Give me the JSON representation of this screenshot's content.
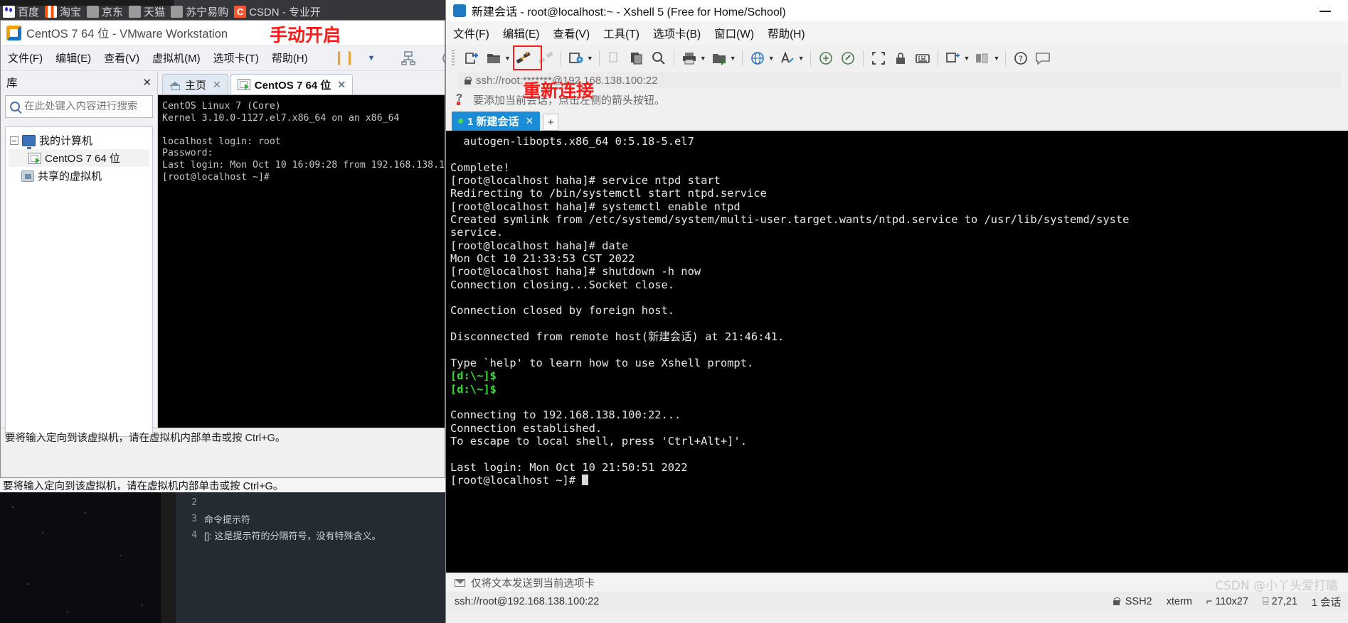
{
  "browser": {
    "bookmarks": [
      {
        "label": "百度",
        "icon": "baidu-favicon"
      },
      {
        "label": "淘宝",
        "icon": "taobao-favicon"
      },
      {
        "label": "京东",
        "icon": "jd-favicon"
      },
      {
        "label": "天猫",
        "icon": "tmall-favicon"
      },
      {
        "label": "苏宁易购",
        "icon": "suning-favicon"
      },
      {
        "label": "CSDN - 专业开",
        "icon": "csdn-favicon"
      }
    ]
  },
  "vmware": {
    "title": "CentOS 7 64 位 - VMware Workstation",
    "annotation": "手动开启",
    "menu": [
      "文件(F)",
      "编辑(E)",
      "查看(V)",
      "虚拟机(M)",
      "选项卡(T)",
      "帮助(H)"
    ],
    "library": {
      "header": "库",
      "close_label": "✕",
      "search_placeholder": "在此处键入内容进行搜索",
      "tree": [
        {
          "label": "我的计算机",
          "icon": "my-computer-icon"
        },
        {
          "label": "CentOS 7 64 位",
          "icon": "virtual-machine-icon"
        },
        {
          "label": "共享的虚拟机",
          "icon": "shared-vms-icon"
        }
      ]
    },
    "tabs": [
      {
        "label": "主页",
        "icon": "home-icon",
        "active": false
      },
      {
        "label": "CentOS 7 64 位",
        "icon": "vm-icon",
        "active": true
      }
    ],
    "console_text": "CentOS Linux 7 (Core)\nKernel 3.10.0-1127.el7.x86_64 on an x86_64\n\nlocalhost login: root\nPassword:\nLast login: Mon Oct 10 16:09:28 from 192.168.138.1\n[root@localhost ~]#",
    "status": "要将输入定向到该虚拟机，请在虚拟机内部单击或按 Ctrl+G。"
  },
  "xshell": {
    "title": "新建会话 - root@localhost:~ - Xshell 5 (Free for Home/School)",
    "minimize_label": "—",
    "menu": [
      "文件(F)",
      "编辑(E)",
      "查看(V)",
      "工具(T)",
      "选项卡(B)",
      "窗口(W)",
      "帮助(H)"
    ],
    "toolbar_icons": [
      "new-session-icon",
      "open-folder-icon",
      "folder-dropdown-caret",
      "reconnect-icon",
      "disconnect-icon",
      "session-properties-icon",
      "properties-dropdown-caret",
      "copy-icon",
      "paste-icon",
      "find-icon",
      "print-icon",
      "print-dropdown-caret",
      "transfer-icon",
      "transfer-dropdown-caret",
      "browser-icon",
      "browser-dropdown-caret",
      "font-icon",
      "font-dropdown-caret",
      "compose-icon",
      "highlight-icon",
      "fullscreen-icon",
      "lock-icon",
      "keyboard-icon",
      "layout-icon",
      "layout-dropdown-caret",
      "arrange-icon",
      "arrange-dropdown-caret",
      "help-icon",
      "chat-icon"
    ],
    "annotation": "重新连接",
    "address": "ssh://root:*******@192.168.138.100:22",
    "hint": "要添加当前会话，点击左侧的箭头按钮。",
    "tab": {
      "label": "1 新建会话",
      "close": "✕"
    },
    "tab_plus": "+",
    "send_bar": "仅将文本发送到当前选项卡",
    "status": {
      "session_path": "ssh://root@192.168.138.100:22",
      "protocol": "SSH2",
      "terminal": "xterm",
      "size": "110x27",
      "cursor": "27,21",
      "sessions": "1 会话"
    },
    "watermark": "CSDN @小丫头爱打瞌",
    "terminal_lines": [
      {
        "text": "  autogen-libopts.x86_64 0:5.18-5.el7",
        "color": "normal"
      },
      {
        "text": "",
        "color": "normal"
      },
      {
        "text": "Complete!",
        "color": "normal"
      },
      {
        "text": "[root@localhost haha]# service ntpd start",
        "color": "normal"
      },
      {
        "text": "Redirecting to /bin/systemctl start ntpd.service",
        "color": "normal"
      },
      {
        "text": "[root@localhost haha]# systemctl enable ntpd",
        "color": "normal"
      },
      {
        "text": "Created symlink from /etc/systemd/system/multi-user.target.wants/ntpd.service to /usr/lib/systemd/syste",
        "color": "normal"
      },
      {
        "text": "service.",
        "color": "normal"
      },
      {
        "text": "[root@localhost haha]# date",
        "color": "normal"
      },
      {
        "text": "Mon Oct 10 21:33:53 CST 2022",
        "color": "normal"
      },
      {
        "text": "[root@localhost haha]# shutdown -h now",
        "color": "normal"
      },
      {
        "text": "Connection closing...Socket close.",
        "color": "normal"
      },
      {
        "text": "",
        "color": "normal"
      },
      {
        "text": "Connection closed by foreign host.",
        "color": "normal"
      },
      {
        "text": "",
        "color": "normal"
      },
      {
        "text": "Disconnected from remote host(新建会话) at 21:46:41.",
        "color": "normal"
      },
      {
        "text": "",
        "color": "normal"
      },
      {
        "text": "Type `help' to learn how to use Xshell prompt.",
        "color": "normal"
      },
      {
        "text": "[d:\\~]$",
        "color": "green"
      },
      {
        "text": "[d:\\~]$",
        "color": "green"
      },
      {
        "text": "",
        "color": "normal"
      },
      {
        "text": "Connecting to 192.168.138.100:22...",
        "color": "normal"
      },
      {
        "text": "Connection established.",
        "color": "normal"
      },
      {
        "text": "To escape to local shell, press 'Ctrl+Alt+]'.",
        "color": "normal"
      },
      {
        "text": "",
        "color": "normal"
      },
      {
        "text": "Last login: Mon Oct 10 21:50:51 2022",
        "color": "normal"
      },
      {
        "text": "[root@localhost ~]# ",
        "color": "normal",
        "cursor": true
      }
    ]
  },
  "editor": {
    "lines": [
      {
        "no": "2",
        "text": ""
      },
      {
        "no": "3",
        "text": "命令提示符"
      },
      {
        "no": "4",
        "text": "[]: 这是提示符的分隔符号，没有特殊含义。"
      }
    ]
  }
}
